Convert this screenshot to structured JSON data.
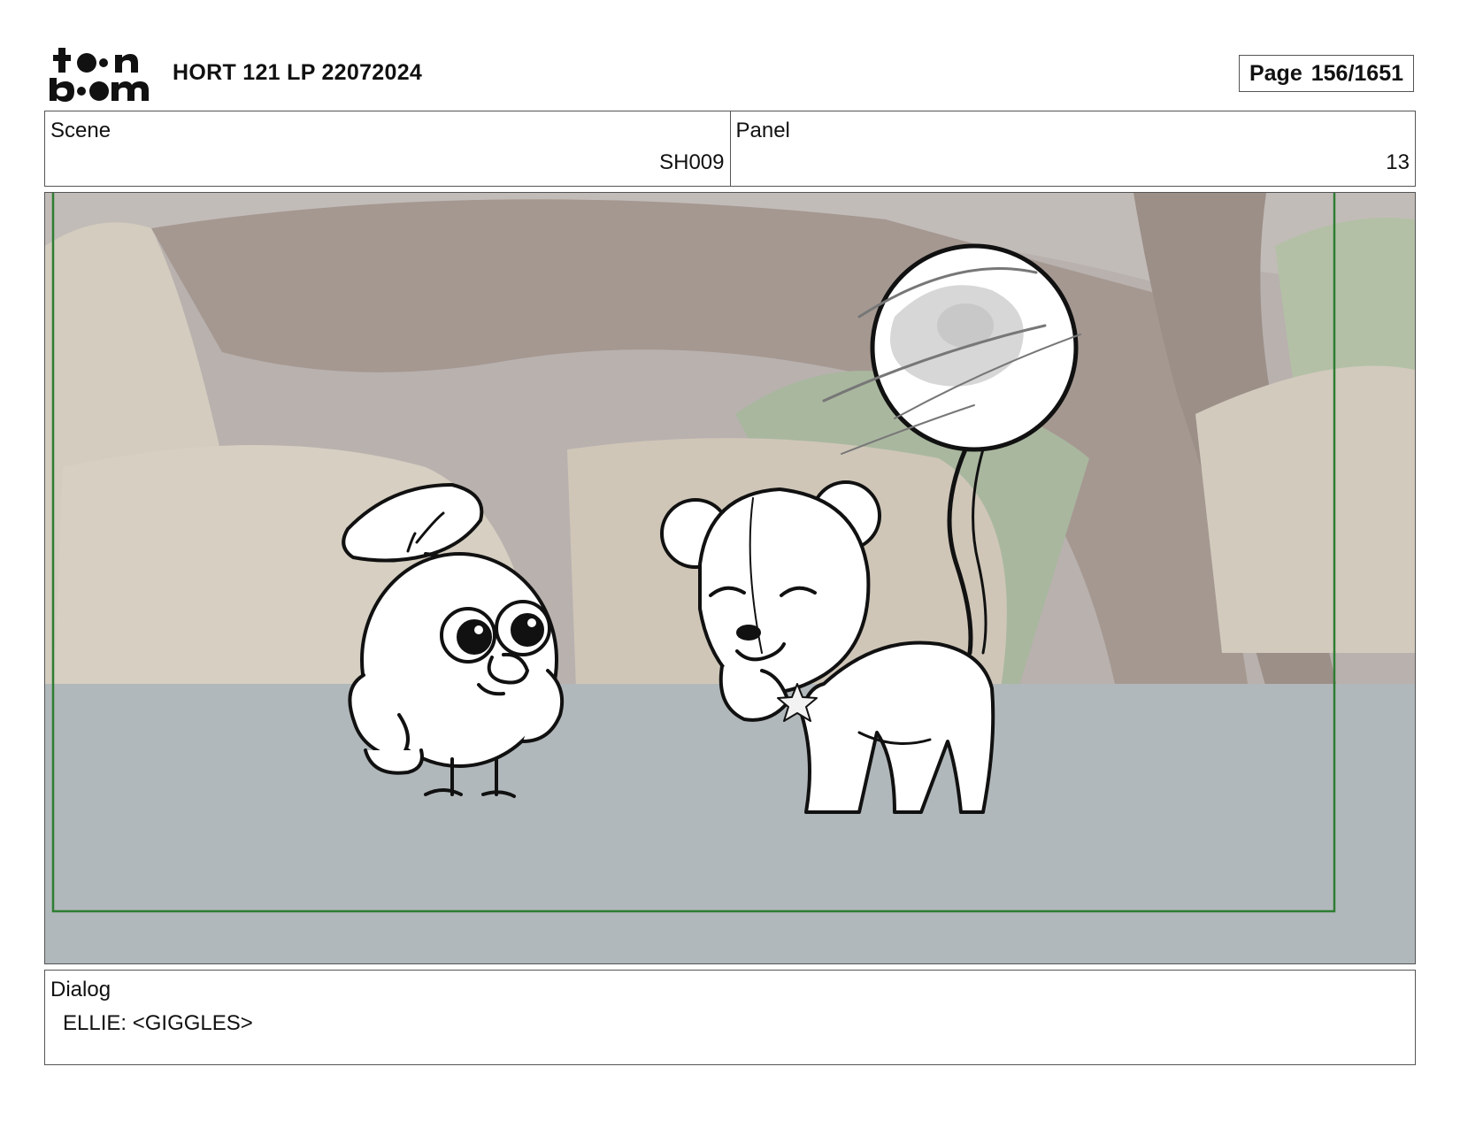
{
  "header": {
    "logo_text": "toon boom",
    "title": "HORT 121 LP 22072024",
    "page_label": "Page",
    "page_value": "156/1651"
  },
  "info": {
    "scene_label": "Scene",
    "scene_value": "SH009",
    "panel_label": "Panel",
    "panel_value": "13"
  },
  "panel": {
    "frame_color": "#2e7d32",
    "ground_color": "#b1b8bb"
  },
  "dialog": {
    "label": "Dialog",
    "line": "ELLIE: <GIGGLES>"
  }
}
